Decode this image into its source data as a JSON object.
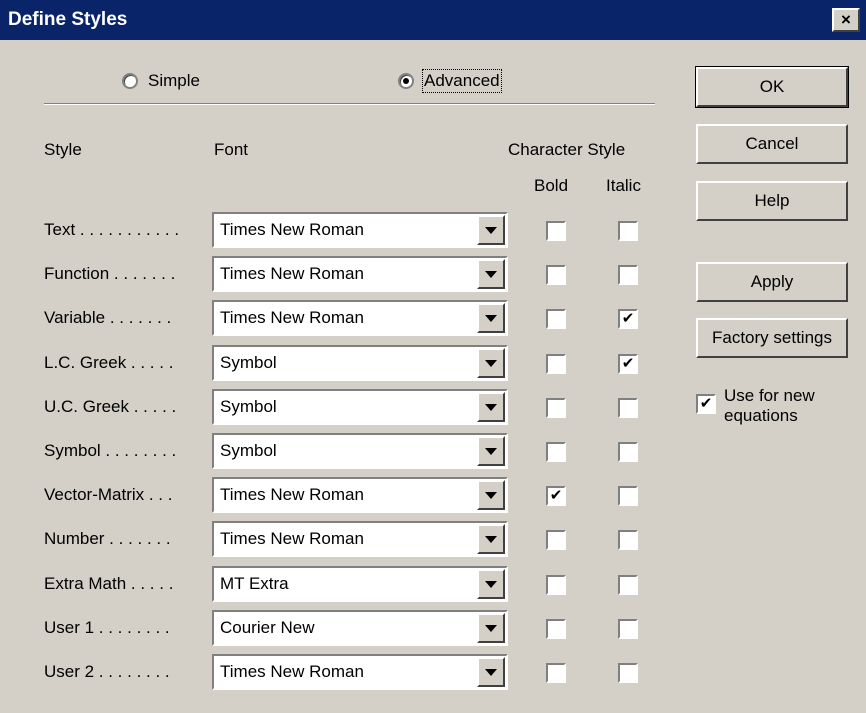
{
  "window": {
    "title": "Define Styles",
    "close_glyph": "×"
  },
  "mode": {
    "simple_label": "Simple",
    "advanced_label": "Advanced",
    "selected": "Advanced"
  },
  "headers": {
    "style": "Style",
    "font": "Font",
    "character_style": "Character Style",
    "bold": "Bold",
    "italic": "Italic"
  },
  "rows": [
    {
      "label": "Text . . . . . . . . . . .",
      "font": "Times New Roman",
      "bold": false,
      "italic": false
    },
    {
      "label": "Function . . . . . . .",
      "font": "Times New Roman",
      "bold": false,
      "italic": false
    },
    {
      "label": "Variable . . . . . . .",
      "font": "Times New Roman",
      "bold": false,
      "italic": true
    },
    {
      "label": "L.C. Greek . . . . .",
      "font": "Symbol",
      "bold": false,
      "italic": true
    },
    {
      "label": "U.C. Greek . . . . .",
      "font": "Symbol",
      "bold": false,
      "italic": false
    },
    {
      "label": "Symbol . . . . . . . .",
      "font": "Symbol",
      "bold": false,
      "italic": false
    },
    {
      "label": "Vector-Matrix . . .",
      "font": "Times New Roman",
      "bold": true,
      "italic": false
    },
    {
      "label": "Number . . . . . . .",
      "font": "Times New Roman",
      "bold": false,
      "italic": false
    },
    {
      "label": "Extra Math . . . . .",
      "font": "MT Extra",
      "bold": false,
      "italic": false
    },
    {
      "label": "User 1 . . . . . . . .",
      "font": "Courier New",
      "bold": false,
      "italic": false
    },
    {
      "label": "User 2 . . . . . . . .",
      "font": "Times New Roman",
      "bold": false,
      "italic": false
    }
  ],
  "buttons": {
    "ok": "OK",
    "cancel": "Cancel",
    "help": "Help",
    "apply": "Apply",
    "factory": "Factory settings"
  },
  "use_for_new": {
    "label": "Use for new equations",
    "checked": true
  },
  "check_glyph": "✔"
}
